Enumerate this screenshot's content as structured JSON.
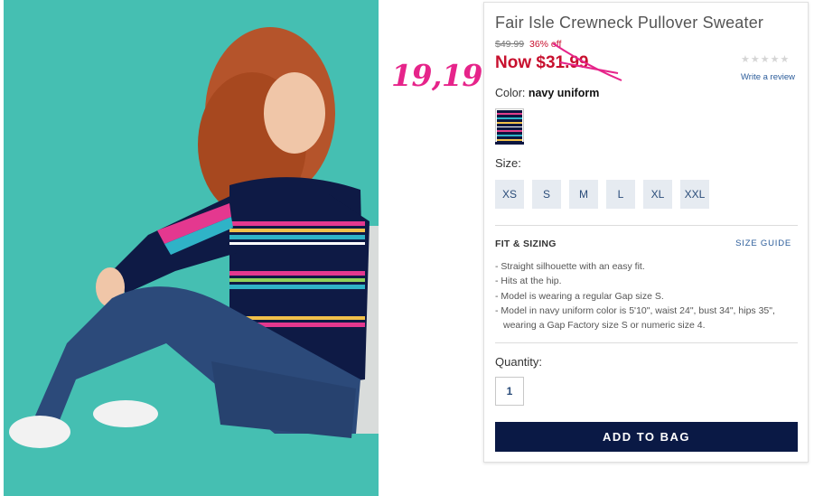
{
  "product": {
    "title": "Fair Isle Crewneck Pullover Sweater",
    "original_price": "$49.99",
    "discount": "36% off",
    "now_price": "Now $31.99",
    "rating_stars": "★★★★★",
    "write_review": "Write a review"
  },
  "annotation": {
    "text": "19,19",
    "color": "#e6248a"
  },
  "color_select": {
    "label": "Color:",
    "value": "navy uniform",
    "swatch_icon": "fair-isle-swatch"
  },
  "size_select": {
    "label": "Size:",
    "options": [
      "XS",
      "S",
      "M",
      "L",
      "XL",
      "XXL"
    ]
  },
  "fit": {
    "title": "FIT & SIZING",
    "size_guide": "SIZE GUIDE",
    "bullets": [
      "- Straight silhouette with an easy fit.",
      "- Hits at the hip.",
      "- Model is wearing a regular Gap size S.",
      "- Model in navy uniform color is 5'10\", waist 24\", bust 34\", hips 35\", wearing a Gap Factory size S or numeric size 4."
    ]
  },
  "quantity": {
    "label": "Quantity:",
    "value": "1"
  },
  "actions": {
    "add_to_bag": "ADD TO BAG"
  },
  "colors": {
    "sale_red": "#c8102e",
    "navy": "#0a1945",
    "link_blue": "#2b5c9a",
    "photo_bg": "#45bfb2"
  }
}
